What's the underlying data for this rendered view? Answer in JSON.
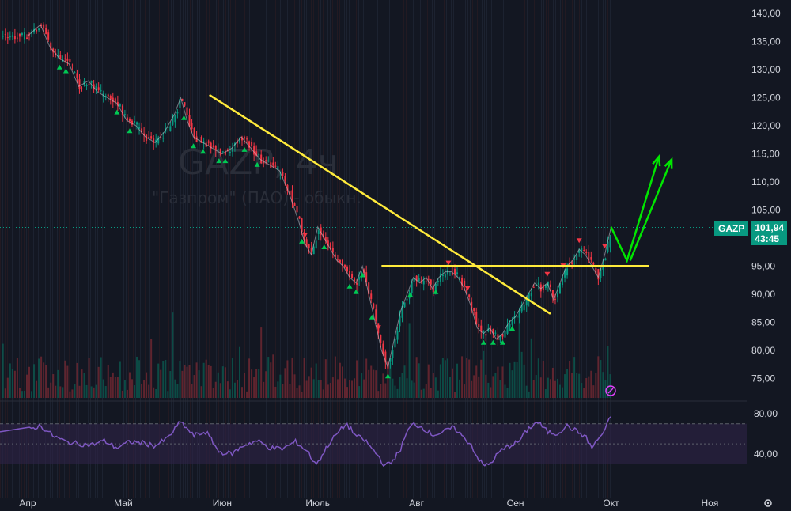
{
  "ticker": "GAZP",
  "watermark": {
    "title": "GAZP, 4ч",
    "subtitle": "\"Газпром\" (ПАО) - обыкн."
  },
  "badge": {
    "symbol": "GAZP",
    "price": "101,94",
    "countdown": "43:45"
  },
  "price_axis": {
    "ticks": [
      {
        "value": 140,
        "label": "140,00"
      },
      {
        "value": 135,
        "label": "135,00"
      },
      {
        "value": 130,
        "label": "130,00"
      },
      {
        "value": 125,
        "label": "125,00"
      },
      {
        "value": 120,
        "label": "120,00"
      },
      {
        "value": 115,
        "label": "115,00"
      },
      {
        "value": 110,
        "label": "110,00"
      },
      {
        "value": 105,
        "label": "105,00"
      },
      {
        "value": 95,
        "label": "95,00"
      },
      {
        "value": 90,
        "label": "90,00"
      },
      {
        "value": 85,
        "label": "85,00"
      },
      {
        "value": 80,
        "label": "80,00"
      },
      {
        "value": 75,
        "label": "75,00"
      }
    ]
  },
  "rsi_axis": {
    "ticks": [
      {
        "value": 80,
        "label": "80,00"
      },
      {
        "value": 40,
        "label": "40,00"
      }
    ]
  },
  "time_axis": {
    "labels": [
      {
        "day": 0,
        "label": "Апр"
      },
      {
        "day": 30,
        "label": "Май"
      },
      {
        "day": 61,
        "label": "Июн"
      },
      {
        "day": 91,
        "label": "Июль"
      },
      {
        "day": 122,
        "label": "Авг"
      },
      {
        "day": 153,
        "label": "Сен"
      },
      {
        "day": 183,
        "label": "Окт"
      },
      {
        "day": 214,
        "label": "Ноя"
      }
    ]
  },
  "colors": {
    "up": "#089981",
    "down": "#f23645",
    "trend": "#ffeb3b",
    "arrow": "#00e600",
    "rsi": "#7e57c2",
    "rsi_band": "#2e2347",
    "bg": "#131722"
  },
  "chart_data": {
    "type": "line",
    "x_unit": "days since 1 Apr",
    "price_series": {
      "name": "GAZP",
      "points": [
        [
          0,
          136
        ],
        [
          4,
          138
        ],
        [
          7,
          134
        ],
        [
          10,
          132
        ],
        [
          13,
          131
        ],
        [
          16,
          127
        ],
        [
          19,
          128
        ],
        [
          22,
          126
        ],
        [
          25,
          125
        ],
        [
          28,
          124
        ],
        [
          31,
          121
        ],
        [
          34,
          120
        ],
        [
          37,
          118
        ],
        [
          40,
          117
        ],
        [
          43,
          119
        ],
        [
          46,
          122
        ],
        [
          48,
          125
        ],
        [
          50,
          121
        ],
        [
          52,
          118
        ],
        [
          55,
          117
        ],
        [
          58,
          116
        ],
        [
          61,
          115
        ],
        [
          64,
          116
        ],
        [
          67,
          118
        ],
        [
          70,
          116
        ],
        [
          73,
          114
        ],
        [
          76,
          113
        ],
        [
          79,
          112
        ],
        [
          82,
          108
        ],
        [
          85,
          103
        ],
        [
          87,
          99
        ],
        [
          89,
          97
        ],
        [
          91,
          102
        ],
        [
          93,
          100
        ],
        [
          95,
          98
        ],
        [
          97,
          96
        ],
        [
          99,
          95
        ],
        [
          101,
          93
        ],
        [
          103,
          92
        ],
        [
          105,
          95
        ],
        [
          107,
          90
        ],
        [
          109,
          85
        ],
        [
          111,
          80
        ],
        [
          113,
          77
        ],
        [
          115,
          82
        ],
        [
          117,
          87
        ],
        [
          119,
          90
        ],
        [
          121,
          93
        ],
        [
          123,
          92
        ],
        [
          125,
          93
        ],
        [
          127,
          91
        ],
        [
          129,
          93
        ],
        [
          131,
          94
        ],
        [
          133,
          94
        ],
        [
          135,
          93
        ],
        [
          137,
          91
        ],
        [
          139,
          88
        ],
        [
          141,
          84
        ],
        [
          143,
          83
        ],
        [
          145,
          84
        ],
        [
          147,
          82
        ],
        [
          149,
          83
        ],
        [
          151,
          85
        ],
        [
          153,
          86
        ],
        [
          155,
          88
        ],
        [
          157,
          90
        ],
        [
          159,
          92
        ],
        [
          161,
          91
        ],
        [
          163,
          92
        ],
        [
          165,
          89
        ],
        [
          167,
          92
        ],
        [
          169,
          95
        ],
        [
          171,
          96
        ],
        [
          173,
          98
        ],
        [
          175,
          97
        ],
        [
          177,
          95
        ],
        [
          179,
          93
        ],
        [
          181,
          97
        ],
        [
          183,
          101.9
        ]
      ]
    },
    "trendline": {
      "from": [
        57,
        125.5
      ],
      "to": [
        164,
        86.5
      ]
    },
    "support_level": {
      "value": 95,
      "from_day": 111,
      "to_day": 195
    },
    "projection_arrows": [
      {
        "path": [
          [
            183,
            102
          ],
          [
            188,
            96
          ],
          [
            198,
            114.5
          ]
        ]
      },
      {
        "path": [
          [
            189,
            96
          ],
          [
            202,
            114
          ]
        ]
      }
    ],
    "rsi_series": {
      "name": "RSI",
      "points": [
        [
          0,
          64
        ],
        [
          4,
          68
        ],
        [
          8,
          58
        ],
        [
          12,
          52
        ],
        [
          16,
          50
        ],
        [
          20,
          49
        ],
        [
          24,
          53
        ],
        [
          28,
          46
        ],
        [
          32,
          52
        ],
        [
          36,
          51
        ],
        [
          40,
          48
        ],
        [
          44,
          56
        ],
        [
          48,
          72
        ],
        [
          52,
          58
        ],
        [
          56,
          62
        ],
        [
          60,
          42
        ],
        [
          64,
          40
        ],
        [
          68,
          49
        ],
        [
          72,
          53
        ],
        [
          76,
          46
        ],
        [
          80,
          45
        ],
        [
          84,
          52
        ],
        [
          88,
          42
        ],
        [
          90,
          30
        ],
        [
          92,
          36
        ],
        [
          94,
          48
        ],
        [
          97,
          60
        ],
        [
          100,
          70
        ],
        [
          103,
          58
        ],
        [
          106,
          53
        ],
        [
          108,
          45
        ],
        [
          110,
          38
        ],
        [
          112,
          28
        ],
        [
          114,
          31
        ],
        [
          117,
          45
        ],
        [
          119,
          62
        ],
        [
          121,
          70
        ],
        [
          124,
          66
        ],
        [
          127,
          59
        ],
        [
          130,
          61
        ],
        [
          133,
          66
        ],
        [
          135,
          63
        ],
        [
          137,
          55
        ],
        [
          139,
          50
        ],
        [
          141,
          37
        ],
        [
          143,
          28
        ],
        [
          145,
          30
        ],
        [
          148,
          42
        ],
        [
          151,
          48
        ],
        [
          154,
          52
        ],
        [
          157,
          65
        ],
        [
          160,
          72
        ],
        [
          163,
          62
        ],
        [
          166,
          60
        ],
        [
          169,
          68
        ],
        [
          172,
          63
        ],
        [
          175,
          57
        ],
        [
          177,
          46
        ],
        [
          179,
          55
        ],
        [
          181,
          63
        ],
        [
          183,
          78
        ]
      ]
    },
    "ylim_price": [
      72,
      142
    ],
    "ylim_rsi": [
      20,
      90
    ],
    "grid": false
  }
}
